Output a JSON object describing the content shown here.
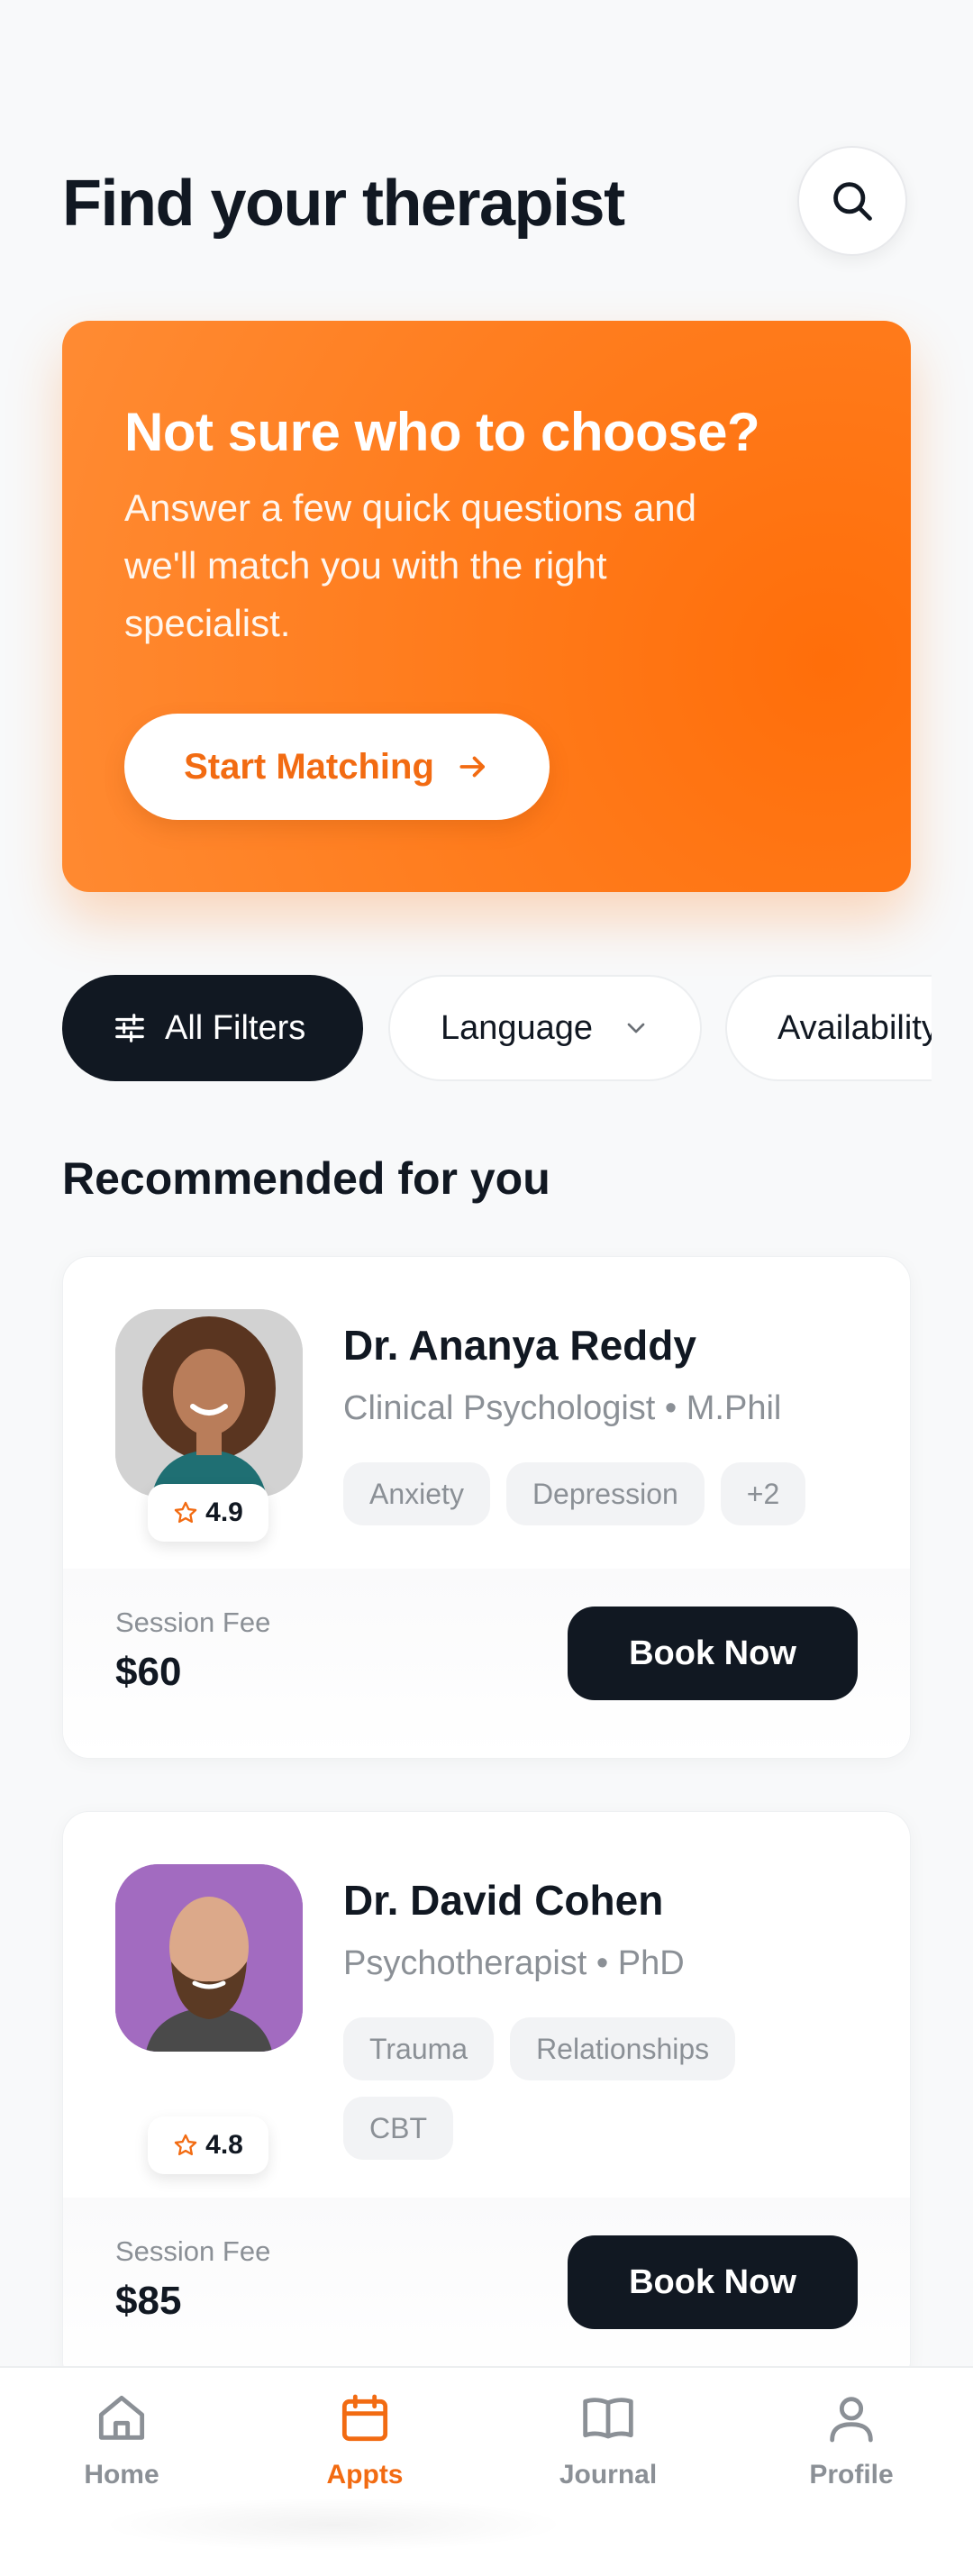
{
  "header": {
    "title": "Find your therapist",
    "search_icon": "search-icon"
  },
  "promo": {
    "title": "Not sure who to choose?",
    "description": "Answer a few quick questions and we'll match you with the right specialist.",
    "cta_label": "Start Matching",
    "accent_color": "#FF7A1A"
  },
  "filters": [
    {
      "label": "All Filters",
      "icon": "sliders-icon",
      "active": true
    },
    {
      "label": "Language",
      "icon": "chevron-down-icon",
      "active": false
    },
    {
      "label": "Availability",
      "active": false
    }
  ],
  "section": {
    "title": "Recommended for you"
  },
  "therapists": [
    {
      "name": "Dr. Ananya Reddy",
      "subtitle": "Clinical Psychologist • M.Phil",
      "rating": "4.9",
      "tags": [
        "Anxiety",
        "Depression",
        "+2"
      ],
      "fee_label": "Session Fee",
      "fee": "$60",
      "book_label": "Book Now"
    },
    {
      "name": "Dr. David Cohen",
      "subtitle": "Psychotherapist • PhD",
      "rating": "4.8",
      "tags": [
        "Trauma",
        "Relationships",
        "CBT"
      ],
      "fee_label": "Session Fee",
      "fee": "$85",
      "book_label": "Book Now"
    }
  ],
  "nav": [
    {
      "label": "Home",
      "icon": "home-icon",
      "active": false
    },
    {
      "label": "Appts",
      "icon": "calendar-icon",
      "active": true
    },
    {
      "label": "Journal",
      "icon": "book-icon",
      "active": false
    },
    {
      "label": "Profile",
      "icon": "user-icon",
      "active": false
    }
  ],
  "colors": {
    "accent": "#F26B12",
    "dark": "#111822",
    "muted": "#8B9096"
  }
}
